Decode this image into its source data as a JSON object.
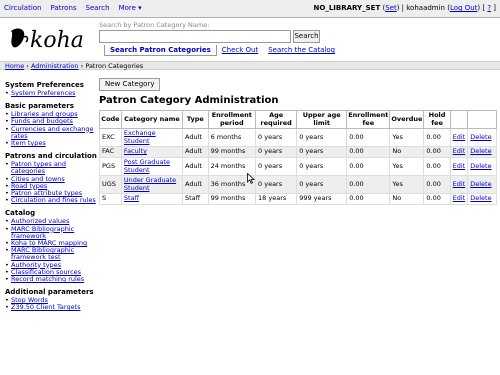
{
  "topnav": [
    "Circulation",
    "Patrons",
    "Search",
    "More ▾"
  ],
  "user": {
    "library": "NO_LIBRARY_SET",
    "set": "Set",
    "name": "kohaadmin",
    "logout": "Log Out",
    "help": "?"
  },
  "logo_text": "koha",
  "search": {
    "label": "Search by Patron Category Name:",
    "value": "",
    "button": "Search"
  },
  "search_tabs": [
    "Search Patron Categories",
    "Check Out",
    "Search the Catalog"
  ],
  "breadcrumb": {
    "home": "Home",
    "admin": "Administration",
    "current": "Patron Categories",
    "sep": "›"
  },
  "sidebar": [
    {
      "heading": "System Preferences",
      "items": [
        "System Preferences"
      ]
    },
    {
      "heading": "Basic parameters",
      "items": [
        "Libraries and groups",
        "Funds and budgets",
        "Currencies and exchange rates",
        "Item types"
      ]
    },
    {
      "heading": "Patrons and circulation",
      "items": [
        "Patron types and categories",
        "Cities and towns",
        "Road types",
        "Patron attribute types",
        "Circulation and fines rules"
      ]
    },
    {
      "heading": "Catalog",
      "items": [
        "Authorized values",
        "MARC Bibliographic framework",
        "Koha to MARC mapping",
        "MARC Bibliographic framework test",
        "Authority types",
        "Classification sources",
        "Record matching rules"
      ]
    },
    {
      "heading": "Additional parameters",
      "items": [
        "Stop Words",
        "Z39.50 Client Targets"
      ]
    }
  ],
  "new_button": "New Category",
  "page_title": "Patron Category Administration",
  "table": {
    "headers": [
      "Code",
      "Category name",
      "Type",
      "Enrollment period",
      "Age required",
      "Upper age limit",
      "Enrollment fee",
      "Overdue",
      "Hold fee",
      "",
      ""
    ],
    "rows": [
      [
        "EXC",
        "Exchange Student",
        "Adult",
        "6 months",
        "0 years",
        "0 years",
        "0.00",
        "Yes",
        "0.00",
        "Edit",
        "Delete"
      ],
      [
        "FAC",
        "Faculty",
        "Adult",
        "99 months",
        "0 years",
        "0 years",
        "0.00",
        "No",
        "0.00",
        "Edit",
        "Delete"
      ],
      [
        "PGS",
        "Post Graduate Student",
        "Adult",
        "24 months",
        "0 years",
        "0 years",
        "0.00",
        "Yes",
        "0.00",
        "Edit",
        "Delete"
      ],
      [
        "UGS",
        "Under Graduate Student",
        "Adult",
        "36 months",
        "0 years",
        "0 years",
        "0.00",
        "Yes",
        "0.00",
        "Edit",
        "Delete"
      ],
      [
        "S",
        "Staff",
        "Staff",
        "99 months",
        "18 years",
        "999 years",
        "0.00",
        "No",
        "0.00",
        "Edit",
        "Delete"
      ]
    ]
  }
}
